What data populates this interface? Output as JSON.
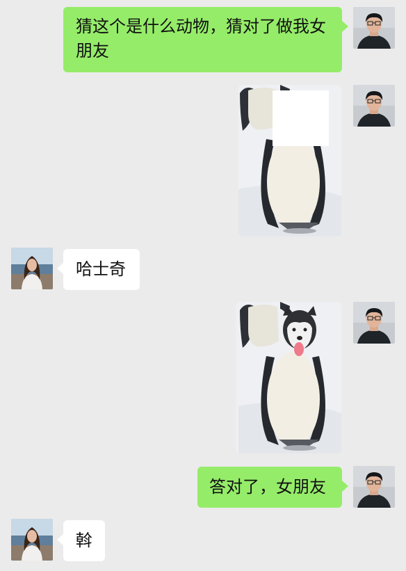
{
  "messages": [
    {
      "sender": "me",
      "type": "text",
      "text": "猜这个是什么动物，猜对了做我女朋友"
    },
    {
      "sender": "me",
      "type": "image",
      "image": "penguin-with-head-covered"
    },
    {
      "sender": "them",
      "type": "text",
      "text": "哈士奇"
    },
    {
      "sender": "me",
      "type": "image",
      "image": "penguin-with-husky-head"
    },
    {
      "sender": "me",
      "type": "text",
      "text": "答对了，女朋友"
    },
    {
      "sender": "them",
      "type": "text",
      "text": "斡"
    }
  ],
  "colors": {
    "background": "#ebebeb",
    "my_bubble": "#95ec69",
    "their_bubble": "#ffffff"
  }
}
